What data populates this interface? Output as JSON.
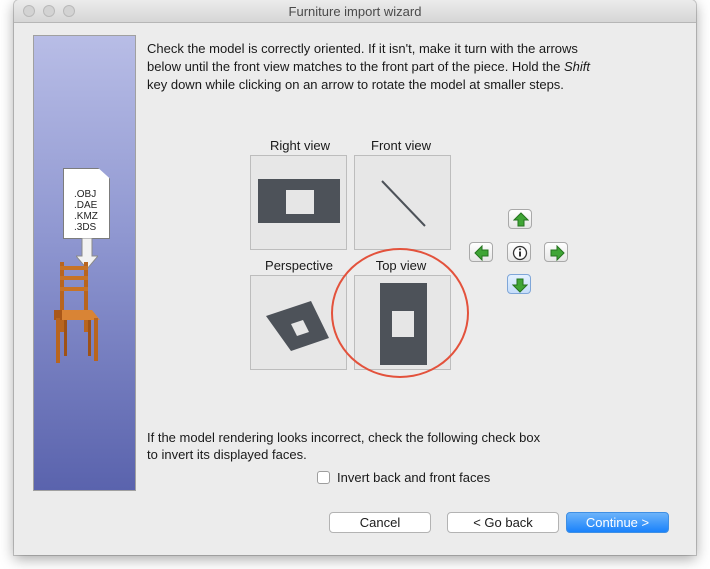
{
  "window": {
    "title": "Furniture import wizard"
  },
  "sidebar": {
    "file_types": [
      ".OBJ",
      ".DAE",
      ".KMZ",
      ".3DS"
    ],
    "icons": [
      "document-icon",
      "down-arrow-icon",
      "chair-icon"
    ]
  },
  "instructions": {
    "line1": "Check the model is correctly oriented. If it isn't, make it turn with the arrows",
    "line2": "below until the front view matches to the front part of the piece. Hold the",
    "shift_word": "Shift",
    "line3": "key down while clicking on an arrow to rotate the model at smaller steps."
  },
  "views": {
    "right": "Right view",
    "front": "Front view",
    "perspective": "Perspective",
    "top": "Top view"
  },
  "rotation_buttons": [
    "arrow-up-icon",
    "arrow-left-icon",
    "info-icon",
    "arrow-right-icon",
    "arrow-down-icon"
  ],
  "faces": {
    "line1": "If the model rendering looks incorrect, check the following check box",
    "line2": "to invert its displayed faces.",
    "checkbox_label": "Invert back and front faces",
    "checked": false
  },
  "buttons": {
    "cancel": "Cancel",
    "back": "< Go back",
    "continue": "Continue >"
  },
  "colors": {
    "accent_blue": "#1a82fb",
    "highlight_circle": "#e3523c",
    "arrow_green": "#3fa535",
    "model_gray": "#4d5259"
  }
}
